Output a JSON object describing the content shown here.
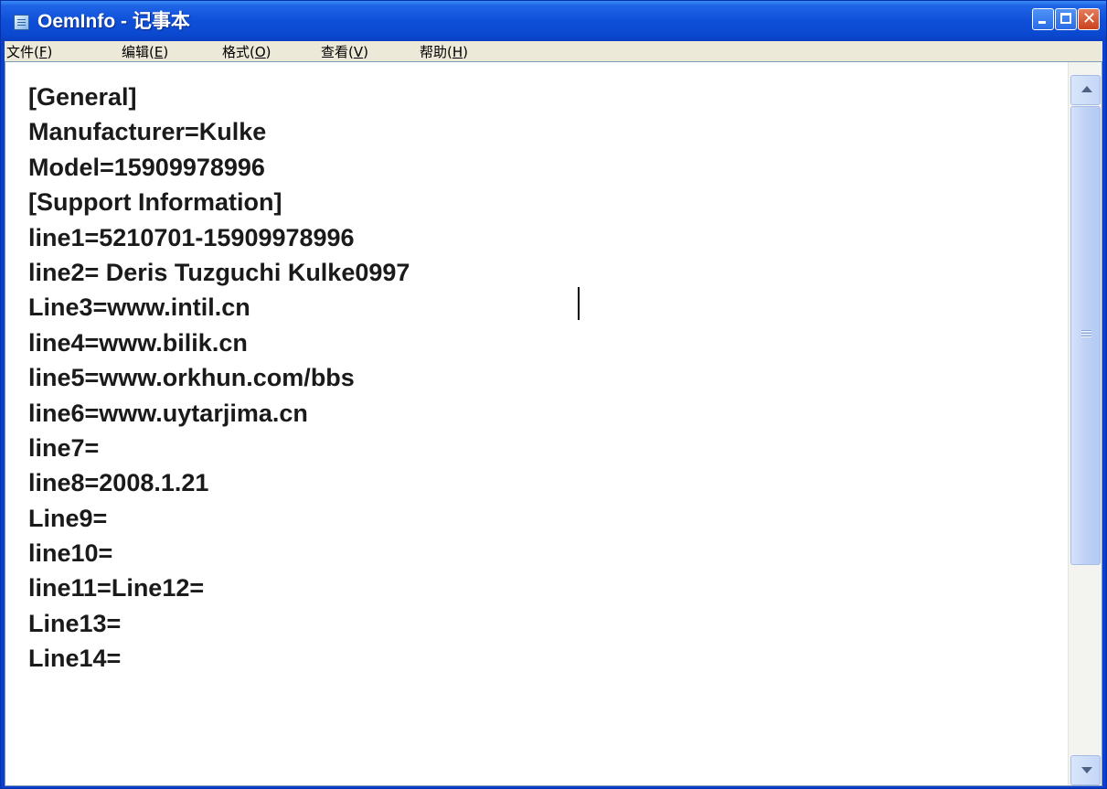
{
  "window": {
    "title": "OemInfo - 记事本"
  },
  "menu": [
    {
      "label": "文件(",
      "accel": "F",
      "suffix": ")"
    },
    {
      "label": "编辑(",
      "accel": "E",
      "suffix": ")"
    },
    {
      "label": "格式(",
      "accel": "O",
      "suffix": ")"
    },
    {
      "label": "查看(",
      "accel": "V",
      "suffix": ")"
    },
    {
      "label": "帮助(",
      "accel": "H",
      "suffix": ")"
    }
  ],
  "document": {
    "lines": [
      "[General]",
      "Manufacturer=Kulke",
      "Model=15909978996",
      "[Support Information]",
      "line1=5210701-15909978996",
      "line2= Deris Tuzguchi Kulke0997",
      "Line3=www.intil.cn",
      "line4=www.bilik.cn",
      "line5=www.orkhun.com/bbs",
      "line6=www.uytarjima.cn",
      "line7=",
      "line8=2008.1.21",
      "Line9=",
      "line10=",
      "line11=Line12=",
      "Line13=",
      "Line14="
    ]
  },
  "icons": {
    "app": "notepad-icon",
    "minimize": "minimize-icon",
    "maximize": "maximize-icon",
    "close": "close-icon",
    "scroll_up": "scroll-up-icon",
    "scroll_down": "scroll-down-icon"
  },
  "colors": {
    "titlebar": "#0a48cf",
    "menubar": "#ece9d8",
    "editor_background": "#ffffff",
    "close_button": "#c9431f"
  }
}
